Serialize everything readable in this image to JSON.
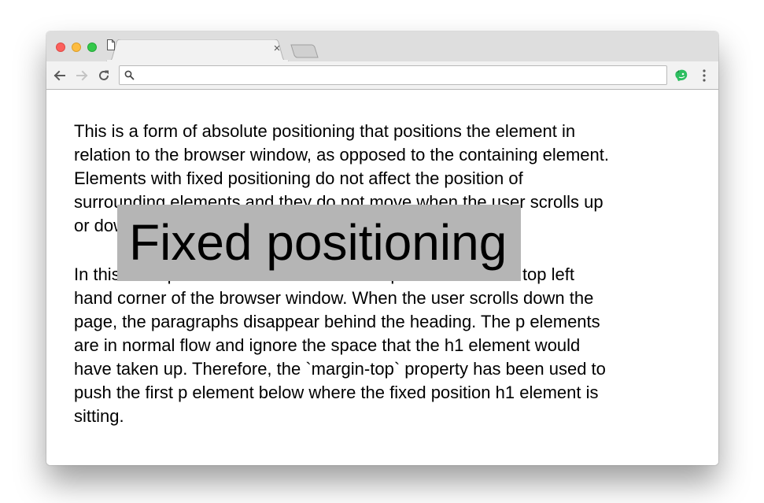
{
  "browser": {
    "tab": {
      "title": "",
      "close_glyph": "×",
      "icon": "page-icon"
    },
    "omnibox": {
      "value": "",
      "placeholder": ""
    },
    "icons": {
      "back": "arrow-left-icon",
      "forward": "arrow-right-icon",
      "reload": "reload-icon",
      "search": "search-icon",
      "extension": "evernote-extension-icon",
      "menu": "kebab-menu-icon"
    },
    "colors": {
      "close": "#fc605c",
      "minimize": "#fdbc40",
      "zoom": "#34c84a",
      "extension": "#2dbe60"
    }
  },
  "page": {
    "heading": "Fixed positioning",
    "heading_bg": "#b5b5b5",
    "paragraphs": [
      "This is a form of absolute positioning that positions the element in relation to the browser window, as opposed to the containing element. Elements with fixed positioning do not affect the position of surrounding elements and they do not move when the user scrolls up or down the page.",
      "In this example the h1 element has been positioned to the top left hand corner of the browser window. When the user scrolls down the page, the paragraphs disappear behind the heading. The p elements are in normal flow and ignore the space that the h1 element would have taken up. Therefore, the `margin-top` property has been used to push the first p element below where the fixed position h1 element is sitting."
    ]
  }
}
